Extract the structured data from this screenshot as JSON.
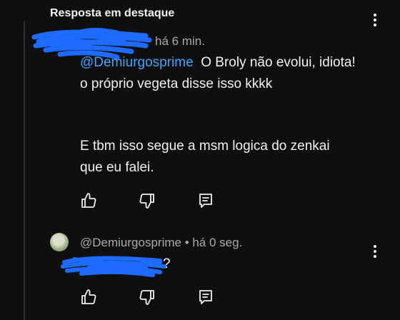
{
  "header": {
    "title": "Resposta em destaque"
  },
  "comment1": {
    "time": "há 6 min.",
    "mention": "@Demiurgosprime",
    "line1_rest": "O Broly não evolui, idiota!",
    "line2": "o próprio vegeta disse isso kkkk",
    "line3": "E tbm isso segue a msm logica do zenkai",
    "line4": "que eu falei.",
    "icons": {
      "like": "thumbs-up-icon",
      "dislike": "thumbs-down-icon",
      "reply": "reply-icon",
      "menu": "more-vert-icon"
    }
  },
  "comment2": {
    "author": "@Demiurgosprime",
    "time": "há 0 seg.",
    "text_end": "?",
    "icons": {
      "like": "thumbs-up-icon",
      "dislike": "thumbs-down-icon",
      "reply": "reply-icon",
      "menu": "more-vert-icon"
    }
  },
  "colors": {
    "background": "#0f0f0f",
    "mention": "#3ea6ff",
    "scribble": "#1e6bff",
    "meta": "#aaaaaa"
  }
}
